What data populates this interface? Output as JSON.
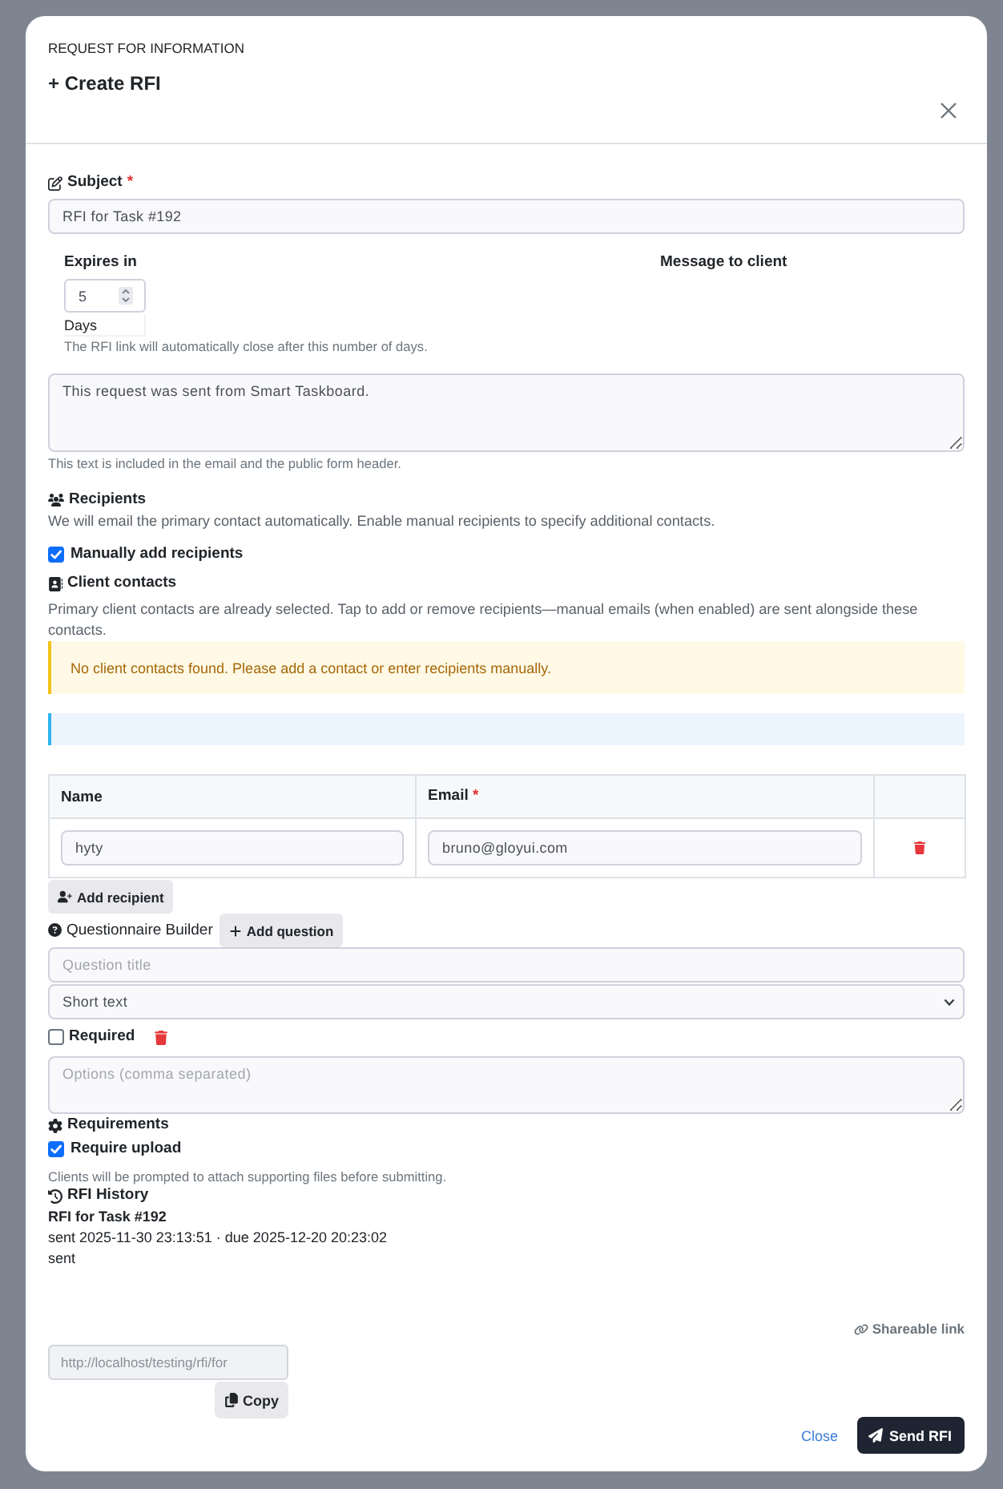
{
  "header": {
    "eyebrow": "REQUEST FOR INFORMATION",
    "title": "+ Create RFI"
  },
  "subject": {
    "label": "Subject",
    "required_mark": "*",
    "value": "RFI for Task #192"
  },
  "expires": {
    "label": "Expires in",
    "value": "5",
    "unit": "Days",
    "help": "The RFI link will automatically close after this number of days."
  },
  "message": {
    "label": "Message to client",
    "value": "This request was sent from Smart Taskboard.",
    "help": "This text is included in the email and the public form header."
  },
  "recipients": {
    "heading": "Recipients",
    "description": "We will email the primary contact automatically. Enable manual recipients to specify additional contacts.",
    "manual_toggle": {
      "label": "Manually add recipients",
      "checked": true
    }
  },
  "client_contacts": {
    "heading": "Client contacts",
    "description": "Primary client contacts are already selected. Tap to add or remove recipients—manual emails (when enabled) are sent alongside these contacts.",
    "alert": "No client contacts found. Please add a contact or enter recipients manually."
  },
  "recipient_table": {
    "columns": [
      {
        "label": "Name"
      },
      {
        "label": "Email",
        "required_mark": "*"
      }
    ],
    "rows": [
      {
        "name": "hyty",
        "email": "bruno@gloyui.com"
      }
    ],
    "add_button": "Add recipient"
  },
  "questionnaire": {
    "heading": "Questionnaire Builder",
    "add_button": "Add question",
    "questions": [
      {
        "title_placeholder": "Question title",
        "type": "Short text",
        "required": {
          "label": "Required",
          "checked": false
        },
        "options_placeholder": "Options (comma separated)"
      }
    ]
  },
  "requirements": {
    "heading": "Requirements",
    "upload": {
      "label": "Require upload",
      "checked": true
    },
    "help": "Clients will be prompted to attach supporting files before submitting."
  },
  "history": {
    "heading": "RFI History",
    "entries": [
      {
        "title": "RFI for Task #192",
        "meta": "sent 2025-11-30 23:13:51 · due 2025-12-20 20:23:02",
        "status": "sent"
      }
    ]
  },
  "share": {
    "label": "Shareable link",
    "url": "http://localhost/testing/rfi/for",
    "copy_button": "Copy"
  },
  "footer": {
    "close": "Close",
    "submit": "Send RFI"
  }
}
